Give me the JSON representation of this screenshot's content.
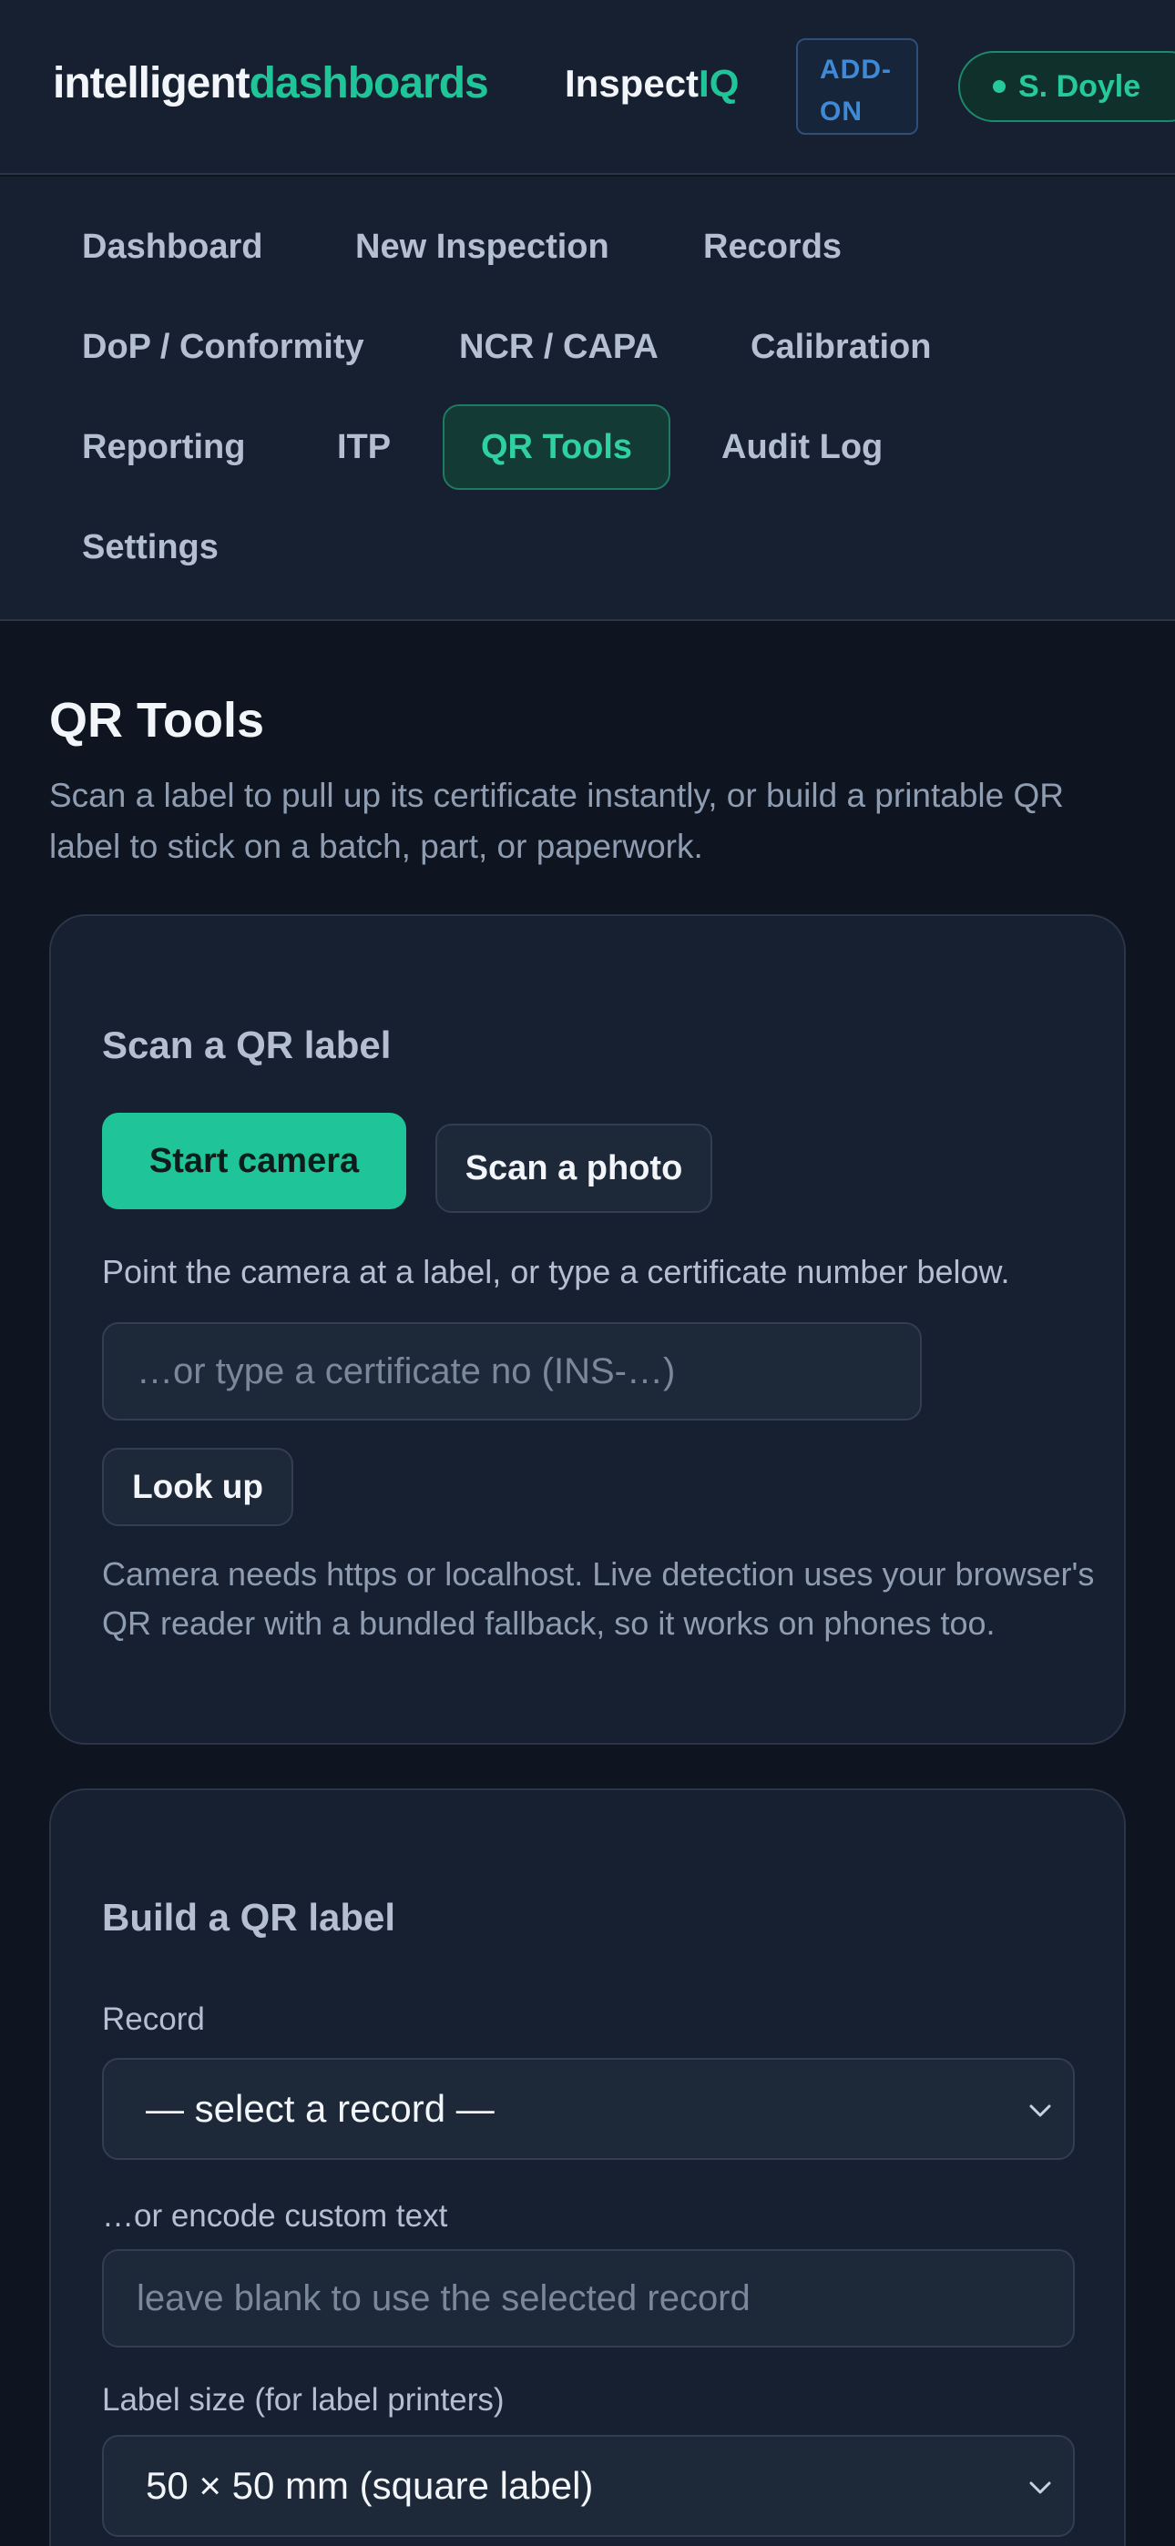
{
  "header": {
    "brand_part1": "intelligent",
    "brand_part2": "dashboards",
    "product_part1": "Inspect",
    "product_part2": "IQ",
    "addon_line1": "ADD-",
    "addon_line2": "ON",
    "user_name": "S. Doyle"
  },
  "nav": {
    "items": [
      {
        "label": "Dashboard"
      },
      {
        "label": "New Inspection"
      },
      {
        "label": "Records"
      },
      {
        "label": "DoP / Conformity"
      },
      {
        "label": "NCR / CAPA"
      },
      {
        "label": "Calibration"
      },
      {
        "label": "Reporting"
      },
      {
        "label": "ITP"
      },
      {
        "label": "QR Tools",
        "active": true
      },
      {
        "label": "Audit Log"
      },
      {
        "label": "Settings"
      }
    ]
  },
  "main": {
    "title": "QR Tools",
    "subtitle": "Scan a label to pull up its certificate instantly, or build a printable QR label to stick on a batch, part, or paperwork."
  },
  "scan_card": {
    "title": "Scan a QR label",
    "start_camera": "Start camera",
    "scan_photo": "Scan a photo",
    "hint": "Point the camera at a label, or type a certificate number below.",
    "cert_placeholder": "…or type a certificate no (INS-…)",
    "look_up": "Look up",
    "note": "Camera needs https or localhost. Live detection uses your browser's QR reader with a bundled fallback, so it works on phones too."
  },
  "build_card": {
    "title": "Build a QR label",
    "record_label": "Record",
    "record_selected": "— select a record —",
    "custom_label": "…or encode custom text",
    "custom_placeholder": "leave blank to use the selected record",
    "size_label": "Label size (for label printers)",
    "size_selected": "50 × 50 mm (square label)"
  },
  "colors": {
    "accent": "#1fc599",
    "background": "#0f1520",
    "panel": "#172030",
    "addon_blue": "#3e8ad6"
  }
}
